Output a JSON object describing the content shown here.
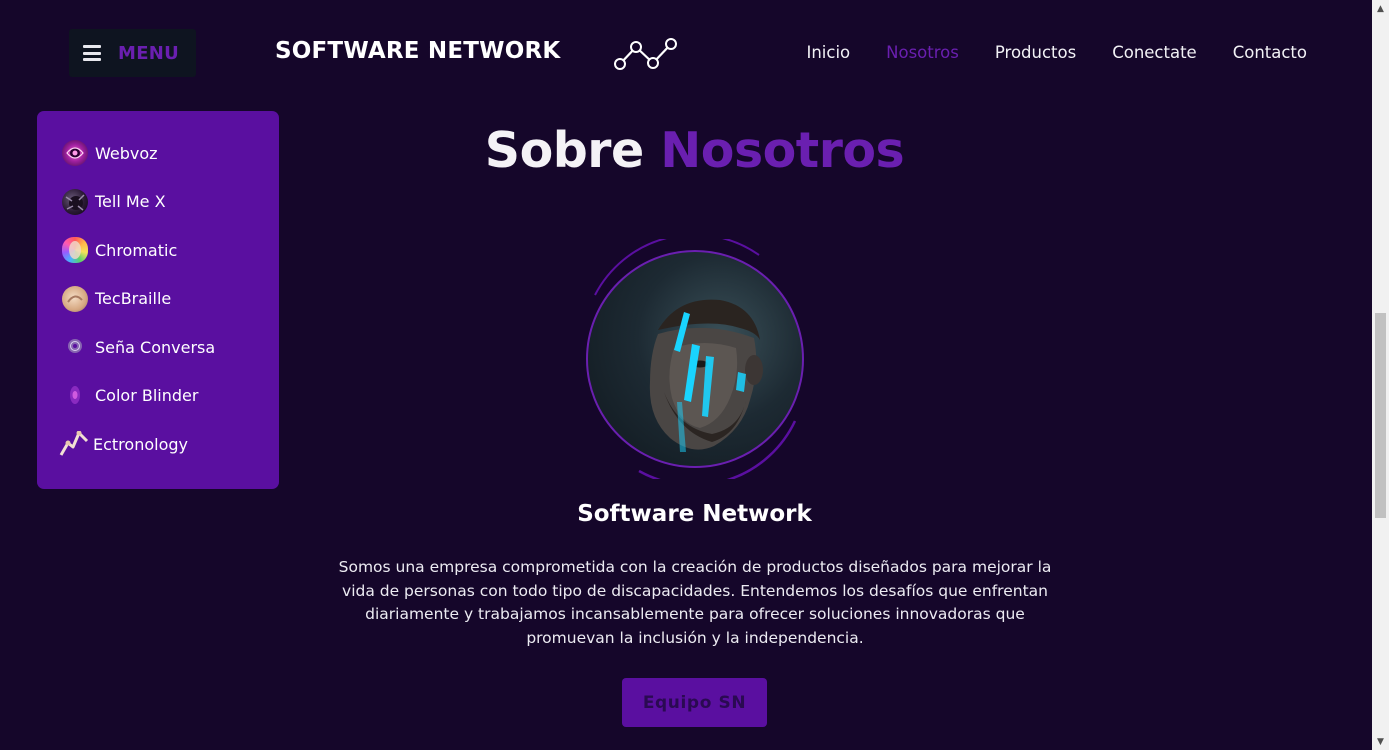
{
  "header": {
    "menu_label": "MENU",
    "brand": "SOFTWARE NETWORK",
    "logo_icon": "network-nodes-icon",
    "nav": [
      {
        "label": "Inicio",
        "active": false
      },
      {
        "label": "Nosotros",
        "active": true
      },
      {
        "label": "Productos",
        "active": false
      },
      {
        "label": "Conectate",
        "active": false
      },
      {
        "label": "Contacto",
        "active": false
      }
    ]
  },
  "sidebar": {
    "items": [
      {
        "label": "Webvoz",
        "icon": "webvoz-icon"
      },
      {
        "label": "Tell Me X",
        "icon": "tell-me-x-icon"
      },
      {
        "label": "Chromatic",
        "icon": "chromatic-icon"
      },
      {
        "label": "TecBraille",
        "icon": "tecbraille-icon"
      },
      {
        "label": "Seña Conversa",
        "icon": "sena-conversa-icon"
      },
      {
        "label": "Color Blinder",
        "icon": "color-blinder-icon"
      },
      {
        "label": "Ectronology",
        "icon": "ectronology-icon"
      }
    ]
  },
  "main": {
    "title_part1": "Sobre",
    "title_part2": "Nosotros",
    "card_name": "Software Network",
    "description": "Somos una empresa comprometida con la creación de productos diseñados para mejorar la vida de personas con todo tipo de discapacidades. Entendemos los desafíos que enfrentan diariamente y trabajamos incansablemente para ofrecer soluciones innovadoras que promuevan la inclusión y la independencia.",
    "team_button": "Equipo SN"
  },
  "colors": {
    "background": "#15062a",
    "accent": "#6a1fb0",
    "sidebar_bg": "#5a0fa0",
    "menu_bg": "#0e1420"
  }
}
